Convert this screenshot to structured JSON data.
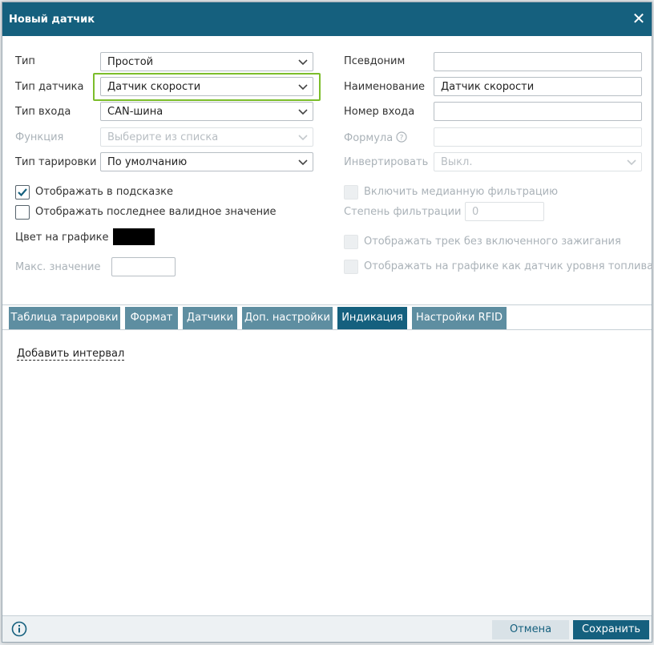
{
  "window": {
    "title": "Новый датчик"
  },
  "left": {
    "type": {
      "label": "Тип",
      "value": "Простой"
    },
    "sensor_type": {
      "label": "Тип датчика",
      "value": "Датчик скорости"
    },
    "input_type": {
      "label": "Тип входа",
      "value": "CAN-шина"
    },
    "function": {
      "label": "Функция",
      "value": "Выберите из списка"
    },
    "calibration_type": {
      "label": "Тип тарировки",
      "value": "По умолчанию"
    },
    "show_in_tooltip": {
      "label": "Отображать в подсказке",
      "checked": true
    },
    "show_last_valid": {
      "label": "Отображать последнее валидное значение",
      "checked": false
    },
    "graph_color": {
      "label": "Цвет на графике",
      "color": "#000000"
    },
    "max_value": {
      "label": "Макс. значение",
      "value": ""
    }
  },
  "right": {
    "alias": {
      "label": "Псевдоним",
      "value": ""
    },
    "name": {
      "label": "Наименование",
      "value": "Датчик скорости"
    },
    "input_number": {
      "label": "Номер входа",
      "value": ""
    },
    "formula": {
      "label": "Формула",
      "value": ""
    },
    "invert": {
      "label": "Инвертировать",
      "value": "Выкл."
    },
    "median_filter": {
      "label": "Включить медианную фильтрацию",
      "checked": false
    },
    "filter_degree": {
      "label": "Степень фильтрации",
      "value": "0"
    },
    "track_no_ignition": {
      "label": "Отображать трек без включенного зажигания",
      "checked": false
    },
    "fuel_level_graph": {
      "label": "Отображать на графике как датчик уровня топлива",
      "checked": false
    }
  },
  "tabs": [
    {
      "label": "Таблица тарировки",
      "active": false
    },
    {
      "label": "Формат",
      "active": false
    },
    {
      "label": "Датчики",
      "active": false
    },
    {
      "label": "Доп. настройки",
      "active": false
    },
    {
      "label": "Индикация",
      "active": true
    },
    {
      "label": "Настройки RFID",
      "active": false
    }
  ],
  "content": {
    "add_interval": "Добавить интервал"
  },
  "footer": {
    "cancel": "Отмена",
    "save": "Сохранить"
  },
  "colors": {
    "primary": "#15607e",
    "tab": "#5e8ea1",
    "highlight": "#7cbd2b"
  }
}
